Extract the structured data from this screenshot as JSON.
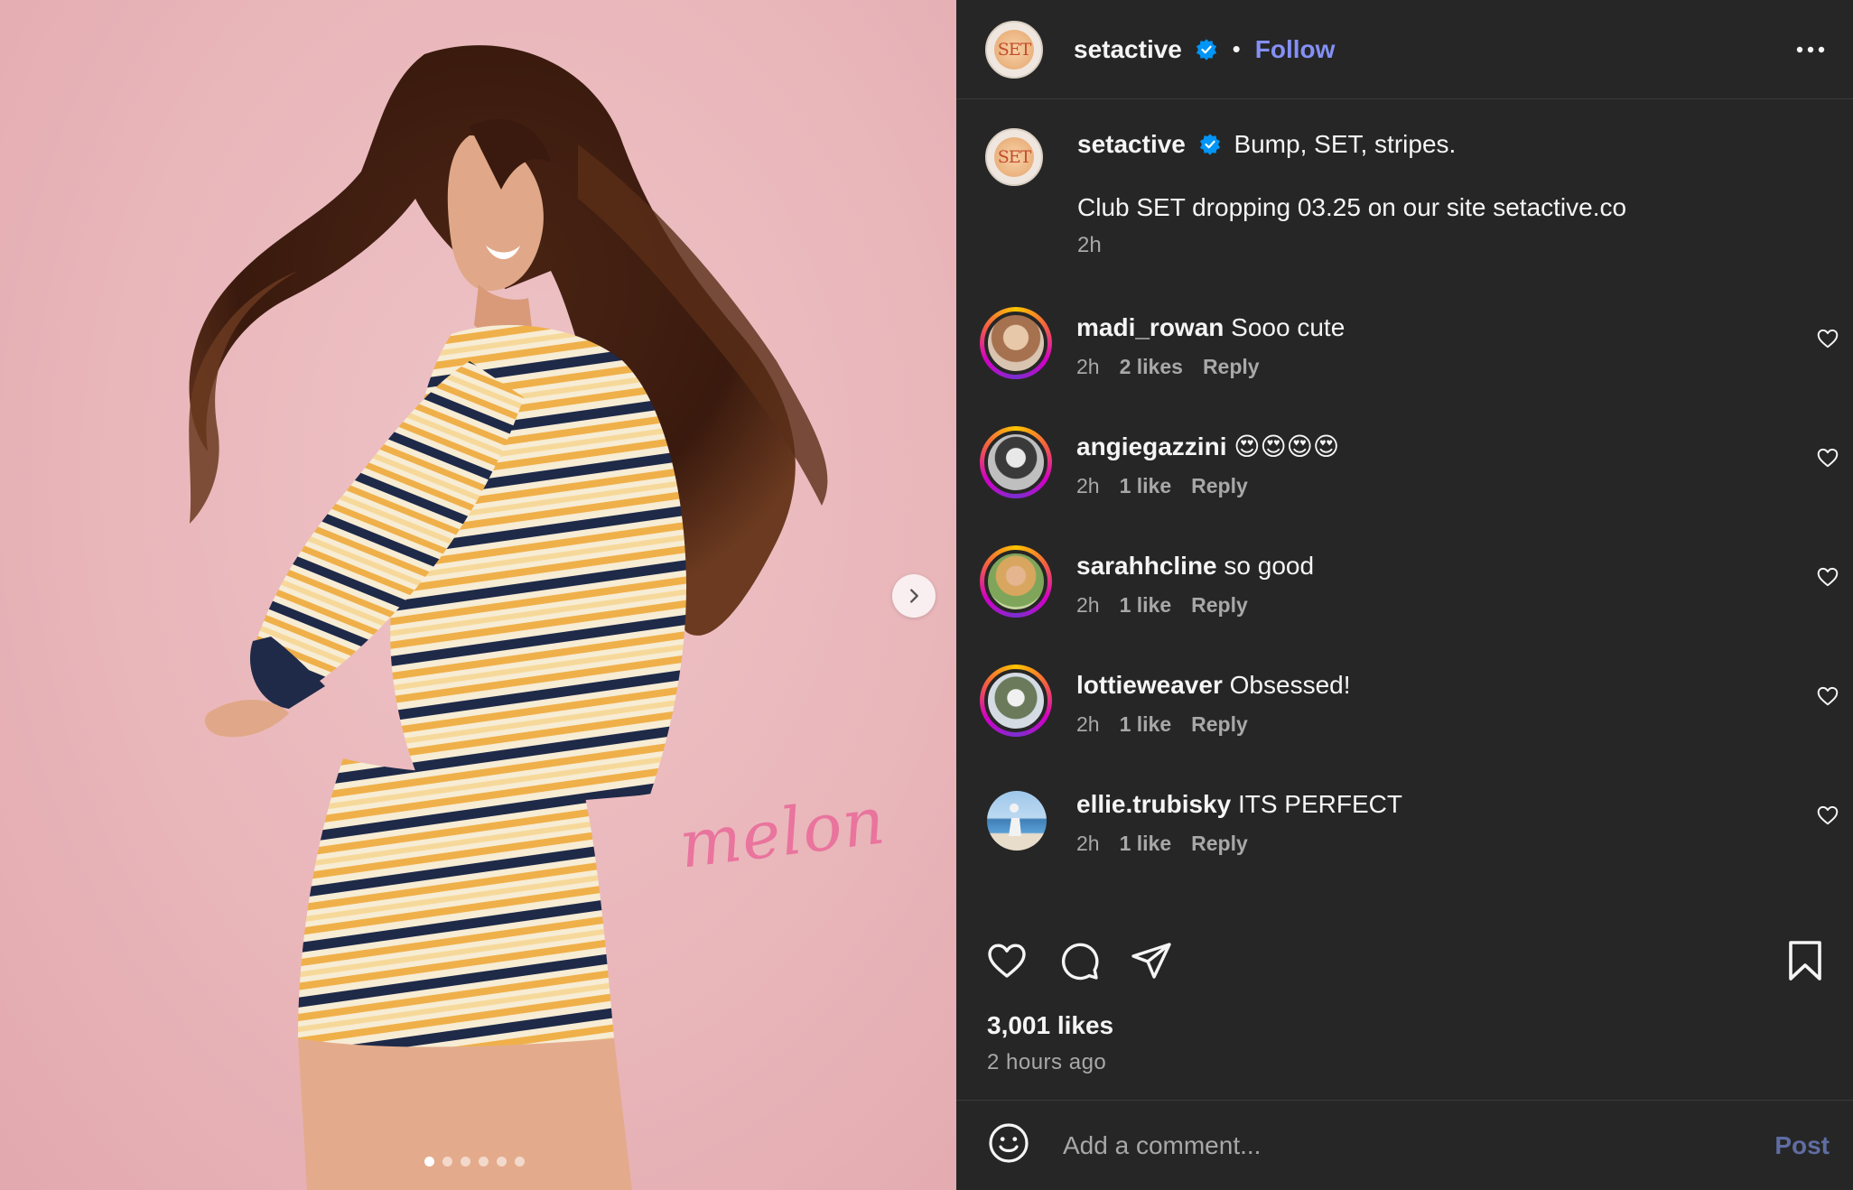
{
  "post": {
    "username": "setactive",
    "avatar_text": "SET",
    "follow_label": "Follow",
    "separator": "•",
    "image_overlay_text": "melon",
    "carousel_total": 6,
    "carousel_active": 1
  },
  "caption": {
    "username": "setactive",
    "line1": "Bump, SET, stripes.",
    "line2": "Club SET dropping 03.25 on our site setactive.co",
    "time": "2h"
  },
  "comments": [
    {
      "username": "madi_rowan",
      "text": "Sooo cute",
      "time": "2h",
      "likes": "2 likes",
      "reply": "Reply"
    },
    {
      "username": "angiegazzini",
      "text": "😍😍😍😍",
      "time": "2h",
      "likes": "1 like",
      "reply": "Reply"
    },
    {
      "username": "sarahhcline",
      "text": "so good",
      "time": "2h",
      "likes": "1 like",
      "reply": "Reply"
    },
    {
      "username": "lottieweaver",
      "text": "Obsessed!",
      "time": "2h",
      "likes": "1 like",
      "reply": "Reply"
    },
    {
      "username": "ellie.trubisky",
      "text": "ITS PERFECT",
      "time": "2h",
      "likes": "1 like",
      "reply": "Reply"
    }
  ],
  "stats": {
    "likes": "3,001 likes",
    "posted_ago": "2 hours ago"
  },
  "composer": {
    "placeholder": "Add a comment...",
    "post_label": "Post"
  },
  "colors": {
    "background": "#262626",
    "link": "#8490f5",
    "verified": "#0095f6",
    "muted_text": "#a8a8a8",
    "photo_background": "#e9b6ba"
  },
  "icons": [
    "verified-badge-icon",
    "more-options-icon",
    "chevron-right-icon",
    "heart-icon",
    "comment-icon",
    "share-icon",
    "bookmark-icon",
    "emoji-icon"
  ]
}
